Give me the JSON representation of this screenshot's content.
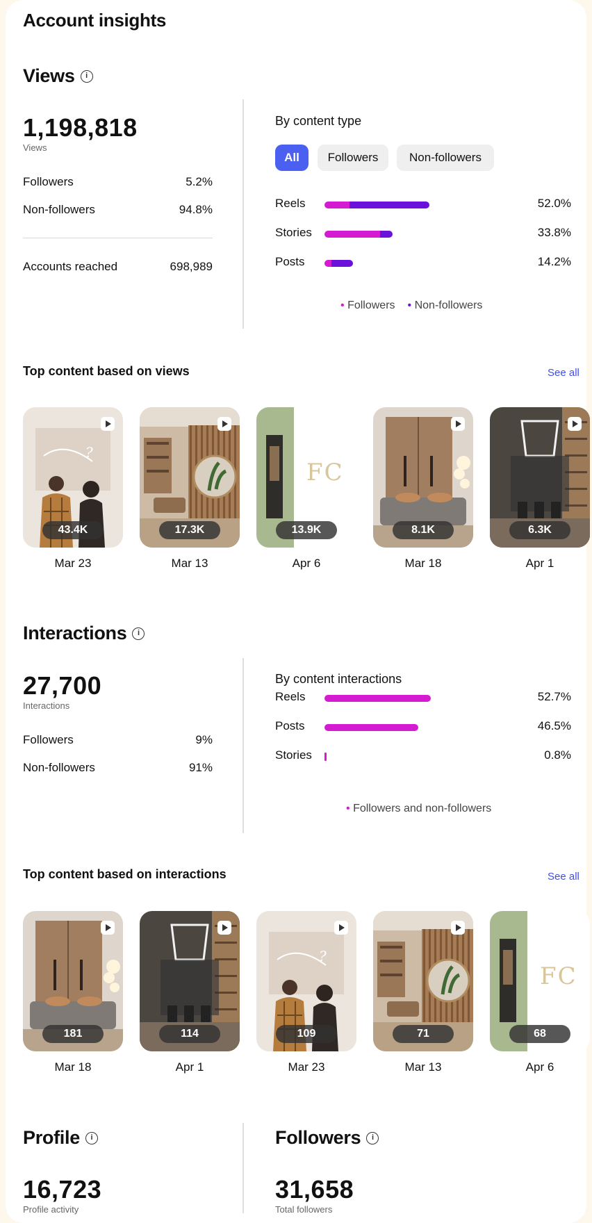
{
  "header": {
    "title": "Account insights"
  },
  "views": {
    "title": "Views",
    "total": "1,198,818",
    "total_label": "Views",
    "rows": [
      {
        "label": "Followers",
        "value": "5.2%"
      },
      {
        "label": "Non-followers",
        "value": "94.8%"
      }
    ],
    "reached_label": "Accounts reached",
    "reached_value": "698,989",
    "by_type_title": "By content type",
    "filters": [
      "All",
      "Followers",
      "Non-followers"
    ],
    "active_filter": "All",
    "bars": [
      {
        "label": "Reels",
        "value": "52.0%",
        "pct": 52.0,
        "followers_share": 0.24
      },
      {
        "label": "Stories",
        "value": "33.8%",
        "pct": 33.8,
        "followers_share": 0.82
      },
      {
        "label": "Posts",
        "value": "14.2%",
        "pct": 14.2,
        "followers_share": 0.25
      }
    ],
    "legend": [
      "Followers",
      "Non-followers"
    ]
  },
  "top_views": {
    "title": "Top content based on views",
    "see_all": "See all",
    "items": [
      {
        "count": "43.4K",
        "date": "Mar 23",
        "scene": "couple",
        "reel": true
      },
      {
        "count": "17.3K",
        "date": "Mar 13",
        "scene": "living",
        "reel": true
      },
      {
        "count": "13.9K",
        "date": "Apr 6",
        "scene": "logo",
        "reel": false
      },
      {
        "count": "8.1K",
        "date": "Mar 18",
        "scene": "bedroom",
        "reel": true
      },
      {
        "count": "6.3K",
        "date": "Apr 1",
        "scene": "office",
        "reel": true
      }
    ]
  },
  "interactions": {
    "title": "Interactions",
    "total": "27,700",
    "total_label": "Interactions",
    "rows": [
      {
        "label": "Followers",
        "value": "9%"
      },
      {
        "label": "Non-followers",
        "value": "91%"
      }
    ],
    "by_title": "By content interactions",
    "bars": [
      {
        "label": "Reels",
        "value": "52.7%",
        "pct": 52.7
      },
      {
        "label": "Posts",
        "value": "46.5%",
        "pct": 46.5
      },
      {
        "label": "Stories",
        "value": "0.8%",
        "pct": 0.8
      }
    ],
    "legend": "Followers and non-followers"
  },
  "top_interactions": {
    "title": "Top content based on interactions",
    "see_all": "See all",
    "items": [
      {
        "count": "181",
        "date": "Mar 18",
        "scene": "bedroom",
        "reel": true
      },
      {
        "count": "114",
        "date": "Apr 1",
        "scene": "office",
        "reel": true
      },
      {
        "count": "109",
        "date": "Mar 23",
        "scene": "couple",
        "reel": true
      },
      {
        "count": "71",
        "date": "Mar 13",
        "scene": "living",
        "reel": true
      },
      {
        "count": "68",
        "date": "Apr 6",
        "scene": "logo",
        "reel": false
      }
    ]
  },
  "profile": {
    "title": "Profile",
    "total": "16,723",
    "total_label": "Profile activity"
  },
  "followers": {
    "title": "Followers",
    "total": "31,658",
    "total_label": "Total followers"
  },
  "colors": {
    "followers": "#d51bd1",
    "non_followers": "#6a12dc",
    "accent": "#4b5ff0",
    "link": "#3f4ee8"
  }
}
